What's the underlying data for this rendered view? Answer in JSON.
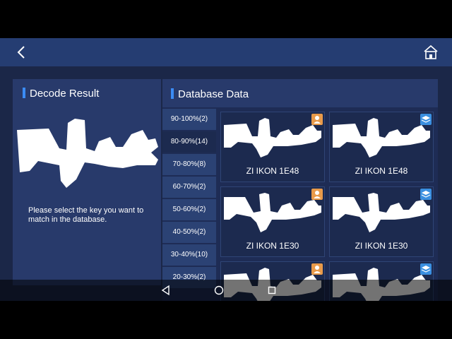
{
  "topbar": {
    "back_icon": "chevron-left-icon",
    "home_icon": "home-icon"
  },
  "left_panel": {
    "title": "Decode Result",
    "hint": "Please select the key you want to match in the database."
  },
  "right_panel": {
    "title": "Database Data",
    "ranges": [
      "90-100%(2)",
      "80-90%(14)",
      "70-80%(8)",
      "60-70%(2)",
      "50-60%(2)",
      "40-50%(2)",
      "30-40%(10)",
      "20-30%(2)"
    ],
    "active_range_index": 1,
    "results": [
      {
        "name": "ZI IKON 1E48",
        "badge": "person-icon"
      },
      {
        "name": "ZI IKON 1E48",
        "badge": "layers-icon"
      },
      {
        "name": "ZI IKON 1E30",
        "badge": "person-icon"
      },
      {
        "name": "ZI IKON 1E30",
        "badge": "layers-icon"
      },
      {
        "name": "",
        "badge": "person-icon"
      },
      {
        "name": "",
        "badge": "layers-icon"
      }
    ]
  },
  "navbar": {
    "back_icon": "nav-back-icon",
    "home_icon": "nav-home-icon",
    "recents_icon": "nav-recents-icon"
  },
  "colors": {
    "accent": "#3b8cf5",
    "badge_person": "#e89a4a",
    "badge_layers": "#3a8fe0"
  }
}
